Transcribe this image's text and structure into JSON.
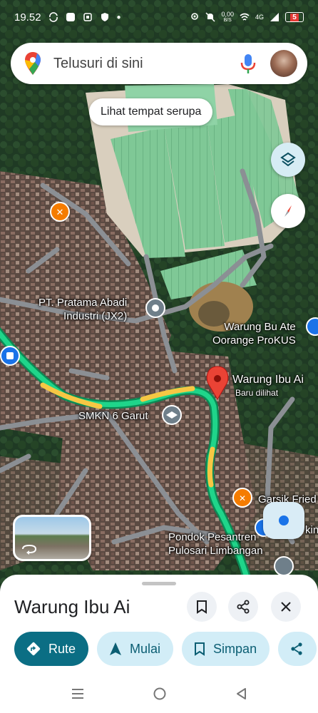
{
  "status_bar": {
    "time": "19.52",
    "net_speed_value": "0,00",
    "net_speed_unit": "B/S",
    "signal_label": "4G",
    "battery": "5"
  },
  "search": {
    "placeholder": "Telusuri di sini"
  },
  "similar_places_chip": "Lihat tempat serupa",
  "map_labels": {
    "factory": "PT. Pratama Abadi\nIndustri (JX2)",
    "warung_bu_ate": "Warung Bu Ate\nOorange ProKUS",
    "selected_place": "Warung Ibu Ai",
    "selected_place_sub": "Baru dilihat",
    "school": "SMKN 6 Garut",
    "garsik": "Garsik Fried",
    "kin": "kin",
    "pesantren": "Pondok Pesantren\nPulosari Limbangan"
  },
  "sheet": {
    "title": "Warung Ibu Ai",
    "actions": [
      {
        "label": "Rute",
        "icon": "directions-icon"
      },
      {
        "label": "Mulai",
        "icon": "navigation-icon"
      },
      {
        "label": "Simpan",
        "icon": "bookmark-icon"
      },
      {
        "label": "",
        "icon": "share-icon"
      }
    ]
  },
  "colors": {
    "accent": "#0b6e84",
    "chip_secondary": "#d2edf7",
    "pin": "#ea4335",
    "route_green": "#1fd58a",
    "route_yellow": "#f6c744"
  }
}
